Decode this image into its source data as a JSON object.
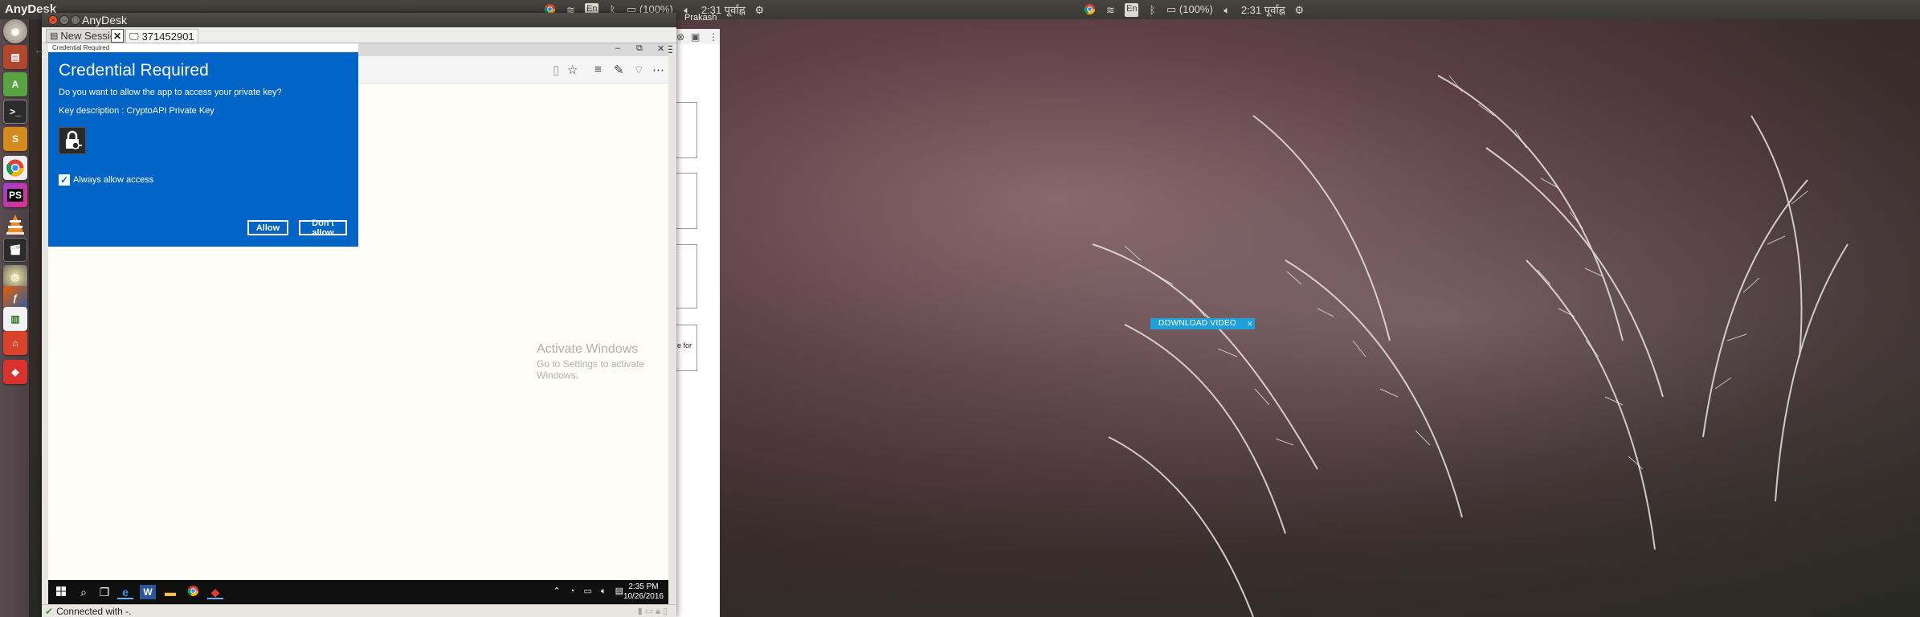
{
  "top_panel": {
    "app_title": "AnyDesk",
    "indicators": [
      "chrome-icon",
      "wifi-icon",
      "keyboard-layout",
      "bluetooth-icon",
      "battery-icon",
      "volume-icon",
      "gear-icon"
    ],
    "keyboard_layout": "En",
    "battery": "(100%)",
    "time": "2:31 पूर्वाह्न"
  },
  "launcher": {
    "items": [
      "dash-icon",
      "files-icon",
      "android-studio-icon",
      "terminal-icon",
      "sublime-text-icon",
      "chrome-icon",
      "phpstorm-icon",
      "vlc-icon",
      "video-editor-icon",
      "system-settings-icon",
      "firefox-icon",
      "libreoffice-icon",
      "software-center-icon",
      "anydesk-icon"
    ],
    "phpstorm_label": "PS"
  },
  "anydesk": {
    "title": "AnyDesk",
    "tabs": {
      "new_session": "New Session",
      "close": "✕",
      "remote_id": "371452901"
    },
    "user": "Prakash",
    "status": "Connected with -."
  },
  "remote": {
    "credential_dialog": {
      "caption": "Credential Required",
      "title": "Credential Required",
      "question": "Do you want to allow the app to access your private key?",
      "key_description": "Key description    : CryptoAPI Private Key",
      "checkbox_label": "Always allow access",
      "checkbox_checked": true,
      "allow": "Allow",
      "deny": "Don't allow",
      "color": "#0063c6"
    },
    "activate_windows": {
      "line1": "Activate Windows",
      "line2": "Go to Settings to activate Windows."
    },
    "taskbar": {
      "time": "2:35 PM",
      "date": "10/26/2016"
    }
  },
  "background_window": {
    "fragment": "e for"
  },
  "overlay": {
    "download_video": "DOWNLOAD VIDEO",
    "close": "✕"
  }
}
